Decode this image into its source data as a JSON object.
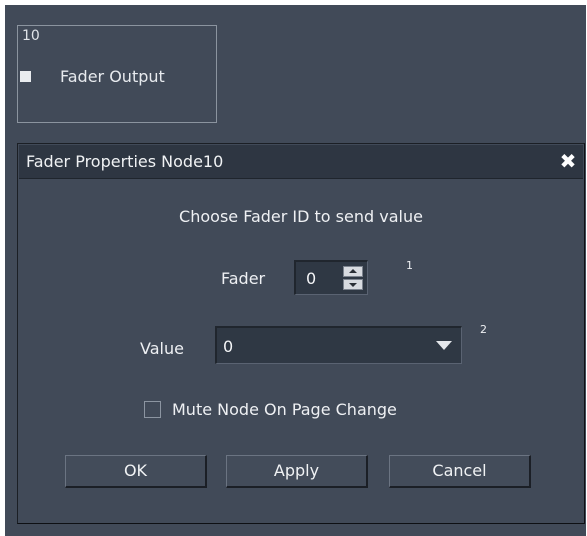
{
  "node": {
    "id": "10",
    "label": "Fader Output"
  },
  "dialog": {
    "title": "Fader Properties Node10",
    "close_label": "✖",
    "instruction": "Choose Fader ID to send value",
    "fader": {
      "label": "Fader",
      "value": "0",
      "hint": "1"
    },
    "value_field": {
      "label": "Value",
      "value": "0",
      "hint": "2"
    },
    "mute_checkbox": {
      "label": "Mute Node On Page Change",
      "checked": false
    },
    "buttons": {
      "ok": "OK",
      "apply": "Apply",
      "cancel": "Cancel"
    }
  },
  "colors": {
    "background": "#414a58",
    "title_bar": "#2e3642",
    "field_bg": "#2f3844",
    "text": "#eef0f3"
  }
}
